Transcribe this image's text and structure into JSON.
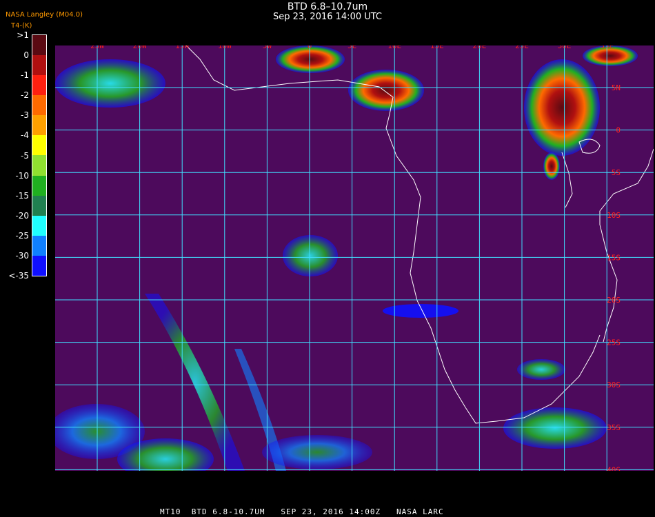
{
  "header": {
    "title": "BTD 6.8–10.7um",
    "subtitle": "Sep 23, 2016 14:00 UTC",
    "credit": "NASA Langley (M04.0)",
    "units": "T4-(K)"
  },
  "legend": {
    "labels": [
      ">1",
      "0",
      "-1",
      "-2",
      "-3",
      "-4",
      "-5",
      "-10",
      "-15",
      "-20",
      "-25",
      "-30",
      "<-35"
    ],
    "colors": [
      "#5a0a12",
      "#b01010",
      "#ff2010",
      "#ff6a00",
      "#ffa000",
      "#ffff00",
      "#90e030",
      "#20b020",
      "#208050",
      "#20ffff",
      "#1080ff",
      "#1010ff",
      "#4d0a5c"
    ]
  },
  "map": {
    "background": "#4d0a5c",
    "grid_color": "#40e0ff",
    "label_color": "#ff2020",
    "coast_color": "#ffffff",
    "longitudes": [
      "25W",
      "20W",
      "15W",
      "10W",
      "5W",
      "0",
      "5E",
      "10E",
      "15E",
      "20E",
      "25E",
      "30E",
      "35E"
    ],
    "latitudes": [
      "5N",
      "0",
      "5S",
      "10S",
      "15S",
      "20S",
      "25S",
      "30S",
      "35S",
      "40S"
    ]
  },
  "footer": {
    "text": "MT10  BTD 6.8-10.7UM   SEP 23, 2016 14:00Z   NASA LARC"
  }
}
